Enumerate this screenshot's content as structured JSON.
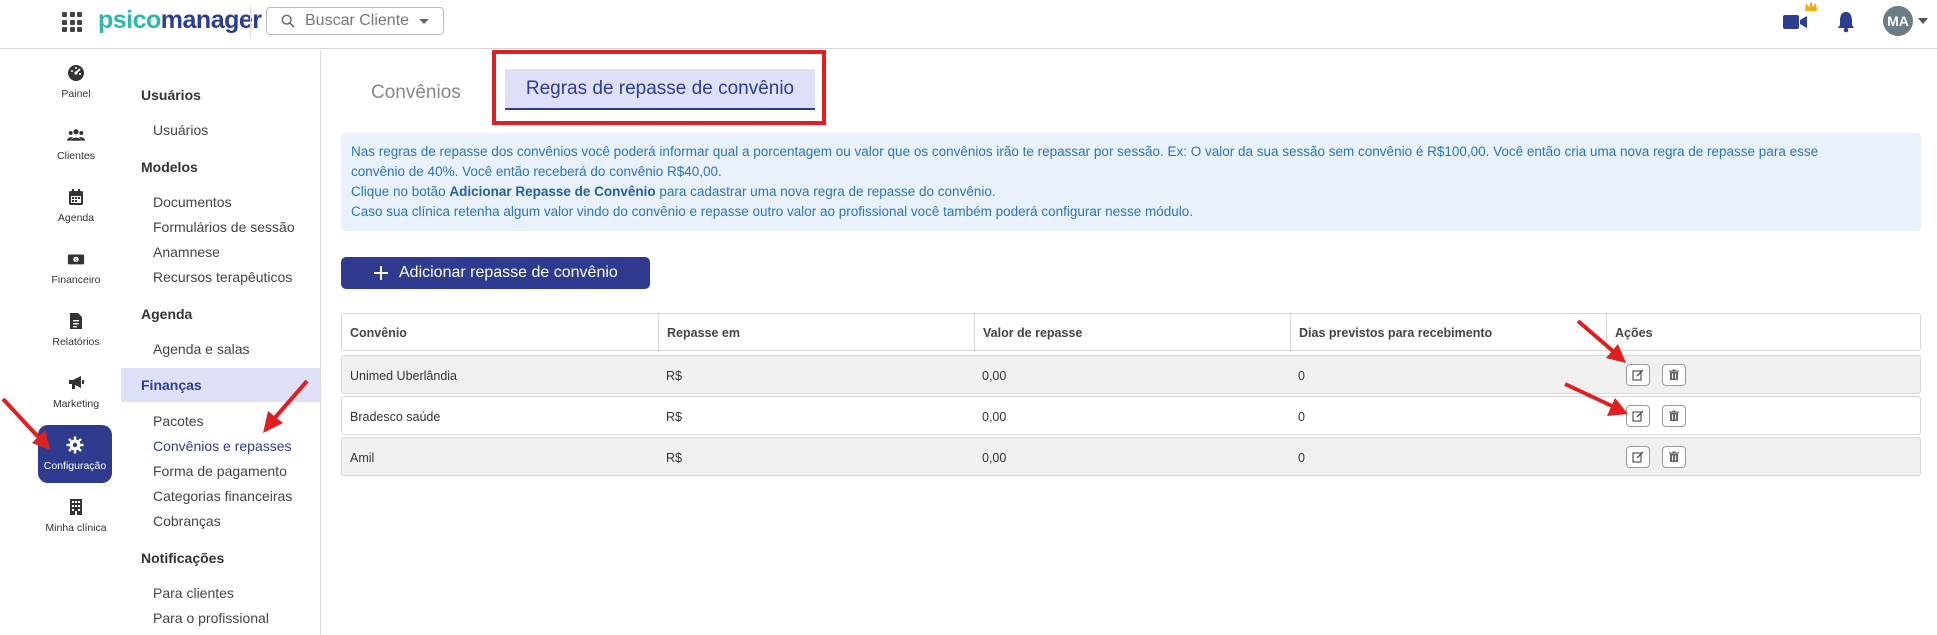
{
  "topbar": {
    "logo_part1": "psico",
    "logo_part2": "manager",
    "search_placeholder": "Buscar Cliente",
    "avatar_initials": "MA"
  },
  "leftnav": {
    "items": [
      {
        "label": "Painel",
        "icon": "dashboard-icon"
      },
      {
        "label": "Clientes",
        "icon": "users-icon"
      },
      {
        "label": "Agenda",
        "icon": "calendar-icon"
      },
      {
        "label": "Financeiro",
        "icon": "money-icon"
      },
      {
        "label": "Relatórios",
        "icon": "document-icon"
      },
      {
        "label": "Marketing",
        "icon": "megaphone-icon"
      },
      {
        "label": "Configuração",
        "icon": "gear-icon"
      },
      {
        "label": "Minha clínica",
        "icon": "building-icon"
      }
    ]
  },
  "submenu": {
    "usuarios_head": "Usuários",
    "usuarios": "Usuários",
    "modelos_head": "Modelos",
    "documentos": "Documentos",
    "formularios": "Formulários de sessão",
    "anamnese": "Anamnese",
    "recursos": "Recursos terapêuticos",
    "agenda_head": "Agenda",
    "agenda_salas": "Agenda e salas",
    "financas_head": "Finanças",
    "pacotes": "Pacotes",
    "convenios_repasses": "Convênios e repasses",
    "forma_pagamento": "Forma de pagamento",
    "categorias": "Categorias financeiras",
    "cobrancas": "Cobranças",
    "notificacoes_head": "Notificações",
    "para_clientes": "Para clientes",
    "para_profissional": "Para o profissional"
  },
  "tabs": {
    "convenios": "Convênios",
    "regras": "Regras de repasse de convênio"
  },
  "info": {
    "line1": "Nas regras de repasse dos convênios você poderá informar qual a porcentagem ou valor que os convênios irão te repassar por sessão. Ex: O valor da sua sessão sem convênio é R$100,00. Você então cria uma nova regra de repasse para esse",
    "line2": "convênio de 40%. Você então receberá do convênio R$40,00.",
    "line3_pre": "Clique no botão ",
    "line3_bold": "Adicionar Repasse de Convênio",
    "line3_post": " para cadastrar uma nova regra de repasse do convênio.",
    "line4": "Caso sua clínica retenha algum valor vindo do convênio e repasse outro valor ao profissional você também poderá configurar nesse módulo."
  },
  "add_button_label": "Adicionar repasse de convênio",
  "table": {
    "headers": [
      "Convênio",
      "Repasse em",
      "Valor de repasse",
      "Dias previstos para recebimento",
      "Ações"
    ],
    "rows": [
      [
        "Unimed Uberlândia",
        "R$",
        "0,00",
        "0"
      ],
      [
        "Bradesco saúde",
        "R$",
        "0,00",
        "0"
      ],
      [
        "Amil",
        "R$",
        "0,00",
        "0"
      ]
    ]
  },
  "colors": {
    "primary": "#2f3b8f",
    "teal": "#2eb8ac",
    "highlight_red": "#e02020",
    "info_bg": "#e9f2fc",
    "info_text": "#2a74b9"
  }
}
